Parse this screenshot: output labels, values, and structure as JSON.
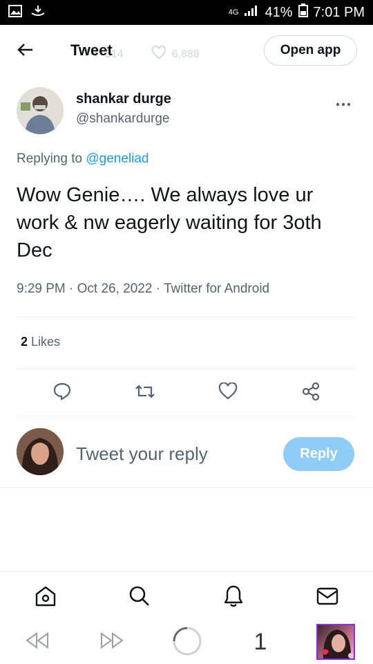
{
  "status_bar": {
    "network": "4G",
    "battery": "41%",
    "time": "7:01 PM"
  },
  "ghost": {
    "retweets": "514",
    "likes": "6,888"
  },
  "header": {
    "title": "Tweet",
    "open_app": "Open app"
  },
  "tweet": {
    "author_name": "shankar durge",
    "author_handle": "@shankardurge",
    "replying_prefix": "Replying to ",
    "replying_to": "@geneliad",
    "text": "Wow Genie…. We always love ur work & nw eagerly waiting for 3oth Dec",
    "meta": "9:29 PM · Oct 26, 2022 · Twitter for Android",
    "likes_count": "2",
    "likes_label": " Likes"
  },
  "composer": {
    "placeholder": "Tweet your reply",
    "reply_label": "Reply"
  },
  "browser": {
    "tab_count": "1"
  },
  "colors": {
    "accent": "#1d9bf0",
    "reply_disabled": "#8ecdf7",
    "muted": "#536471"
  }
}
